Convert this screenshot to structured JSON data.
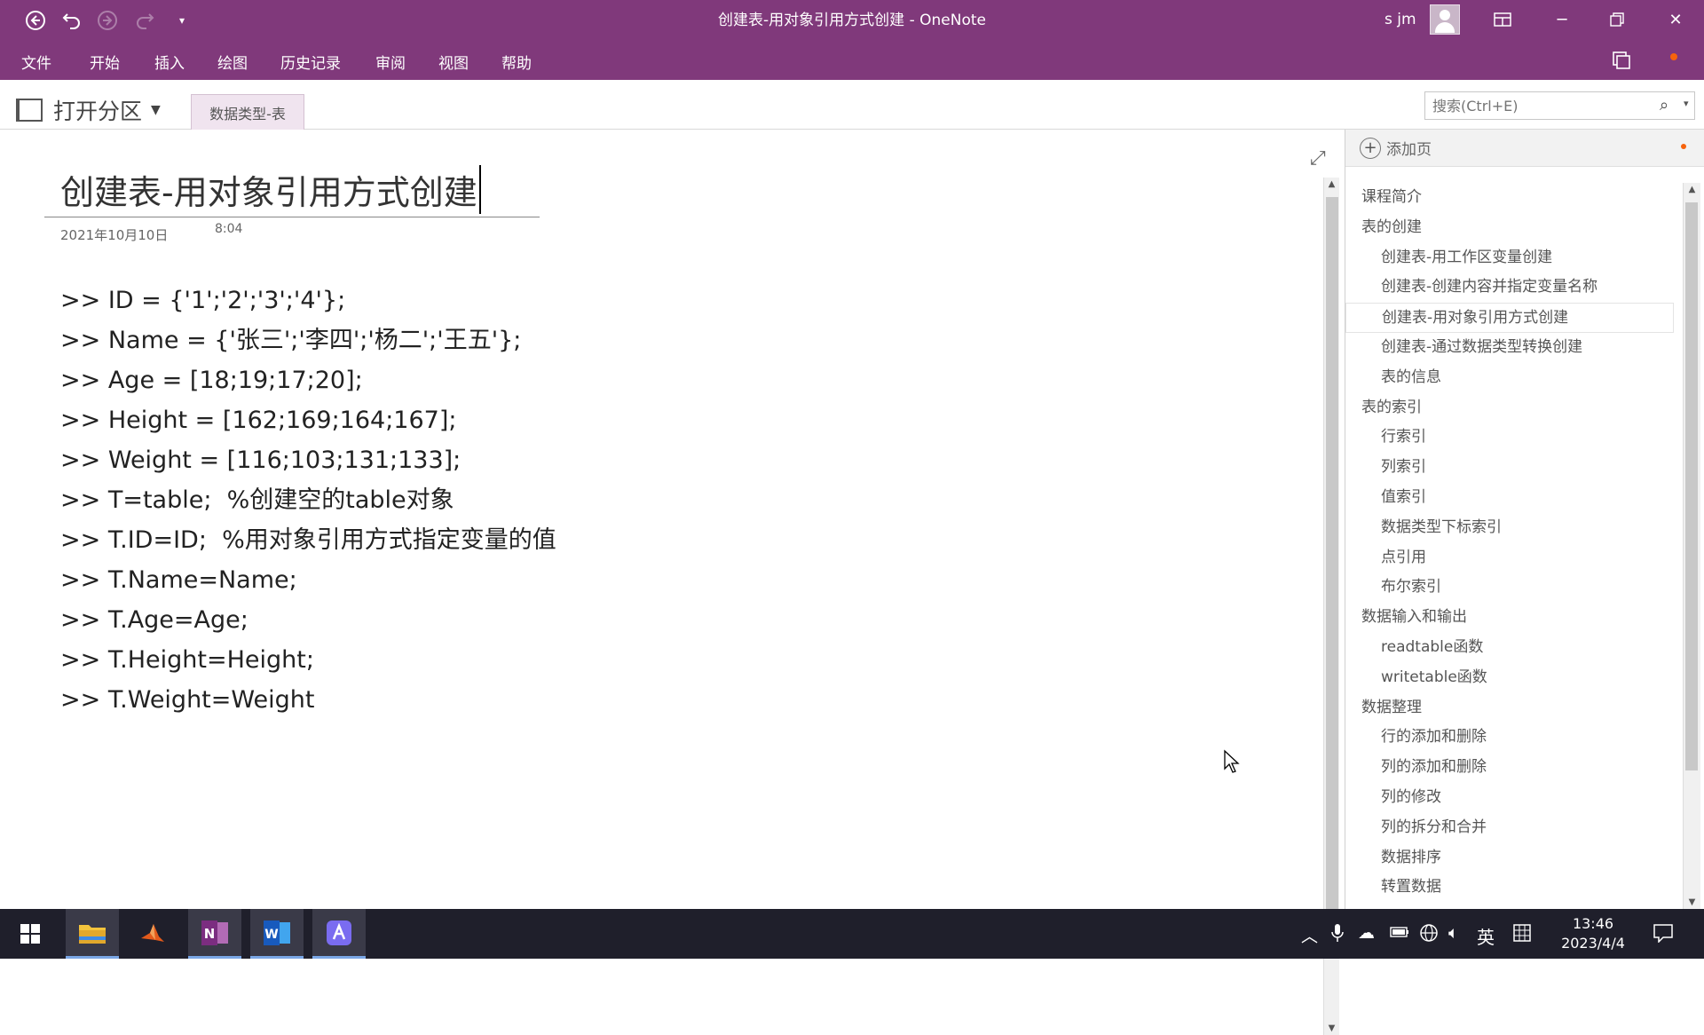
{
  "window": {
    "title": "创建表-用对象引用方式创建 - OneNote",
    "user": "s jm",
    "qat": [
      "back-icon",
      "undo-icon",
      "forward-icon",
      "redo-icon",
      "customize-icon"
    ]
  },
  "menu": [
    "文件",
    "开始",
    "插入",
    "绘图",
    "历史记录",
    "审阅",
    "视图",
    "帮助"
  ],
  "section": {
    "open_label": "打开分区",
    "tab": "数据类型-表",
    "search_placeholder": "搜索(Ctrl+E)"
  },
  "page": {
    "title": "创建表-用对象引用方式创建",
    "date": "2021年10月10日",
    "time": "8:04",
    "code_lines": [
      ">> ID = {'1';'2';'3';'4'};",
      ">> Name = {'张三';'李四';'杨二';'王五'};",
      ">> Age = [18;19;17;20];",
      ">> Height = [162;169;164;167];",
      ">> Weight = [116;103;131;133];",
      ">> T=table;  %创建空的table对象",
      ">> T.ID=ID;  %用对象引用方式指定变量的值",
      ">> T.Name=Name;",
      ">> T.Age=Age;",
      ">> T.Height=Height;",
      ">> T.Weight=Weight"
    ]
  },
  "pane": {
    "add_page": "添加页",
    "pages": [
      {
        "label": "课程简介",
        "level": 0
      },
      {
        "label": "表的创建",
        "level": 0
      },
      {
        "label": "创建表-用工作区变量创建",
        "level": 1
      },
      {
        "label": "创建表-创建内容并指定变量名称",
        "level": 1
      },
      {
        "label": "创建表-用对象引用方式创建",
        "level": 1,
        "selected": true
      },
      {
        "label": "创建表-通过数据类型转换创建",
        "level": 1
      },
      {
        "label": "表的信息",
        "level": 1
      },
      {
        "label": "表的索引",
        "level": 0
      },
      {
        "label": "行索引",
        "level": 1
      },
      {
        "label": "列索引",
        "level": 1
      },
      {
        "label": "值索引",
        "level": 1
      },
      {
        "label": "数据类型下标索引",
        "level": 1
      },
      {
        "label": "点引用",
        "level": 1
      },
      {
        "label": "布尔索引",
        "level": 1
      },
      {
        "label": "数据输入和输出",
        "level": 0
      },
      {
        "label": "readtable函数",
        "level": 1
      },
      {
        "label": "writetable函数",
        "level": 1
      },
      {
        "label": "数据整理",
        "level": 0
      },
      {
        "label": "行的添加和删除",
        "level": 1
      },
      {
        "label": "列的添加和删除",
        "level": 1
      },
      {
        "label": "列的修改",
        "level": 1
      },
      {
        "label": "列的拆分和合并",
        "level": 1
      },
      {
        "label": "数据排序",
        "level": 1
      },
      {
        "label": "转置数据",
        "level": 1
      }
    ]
  },
  "taskbar": {
    "apps": [
      "start-icon",
      "file-explorer-icon",
      "matlab-icon",
      "onenote-icon",
      "word-icon",
      "app-icon"
    ],
    "ime": "英",
    "time": "13:46",
    "date": "2023/4/4"
  },
  "colors": {
    "brand": "#80397b",
    "taskbar": "#1f1f2b"
  }
}
